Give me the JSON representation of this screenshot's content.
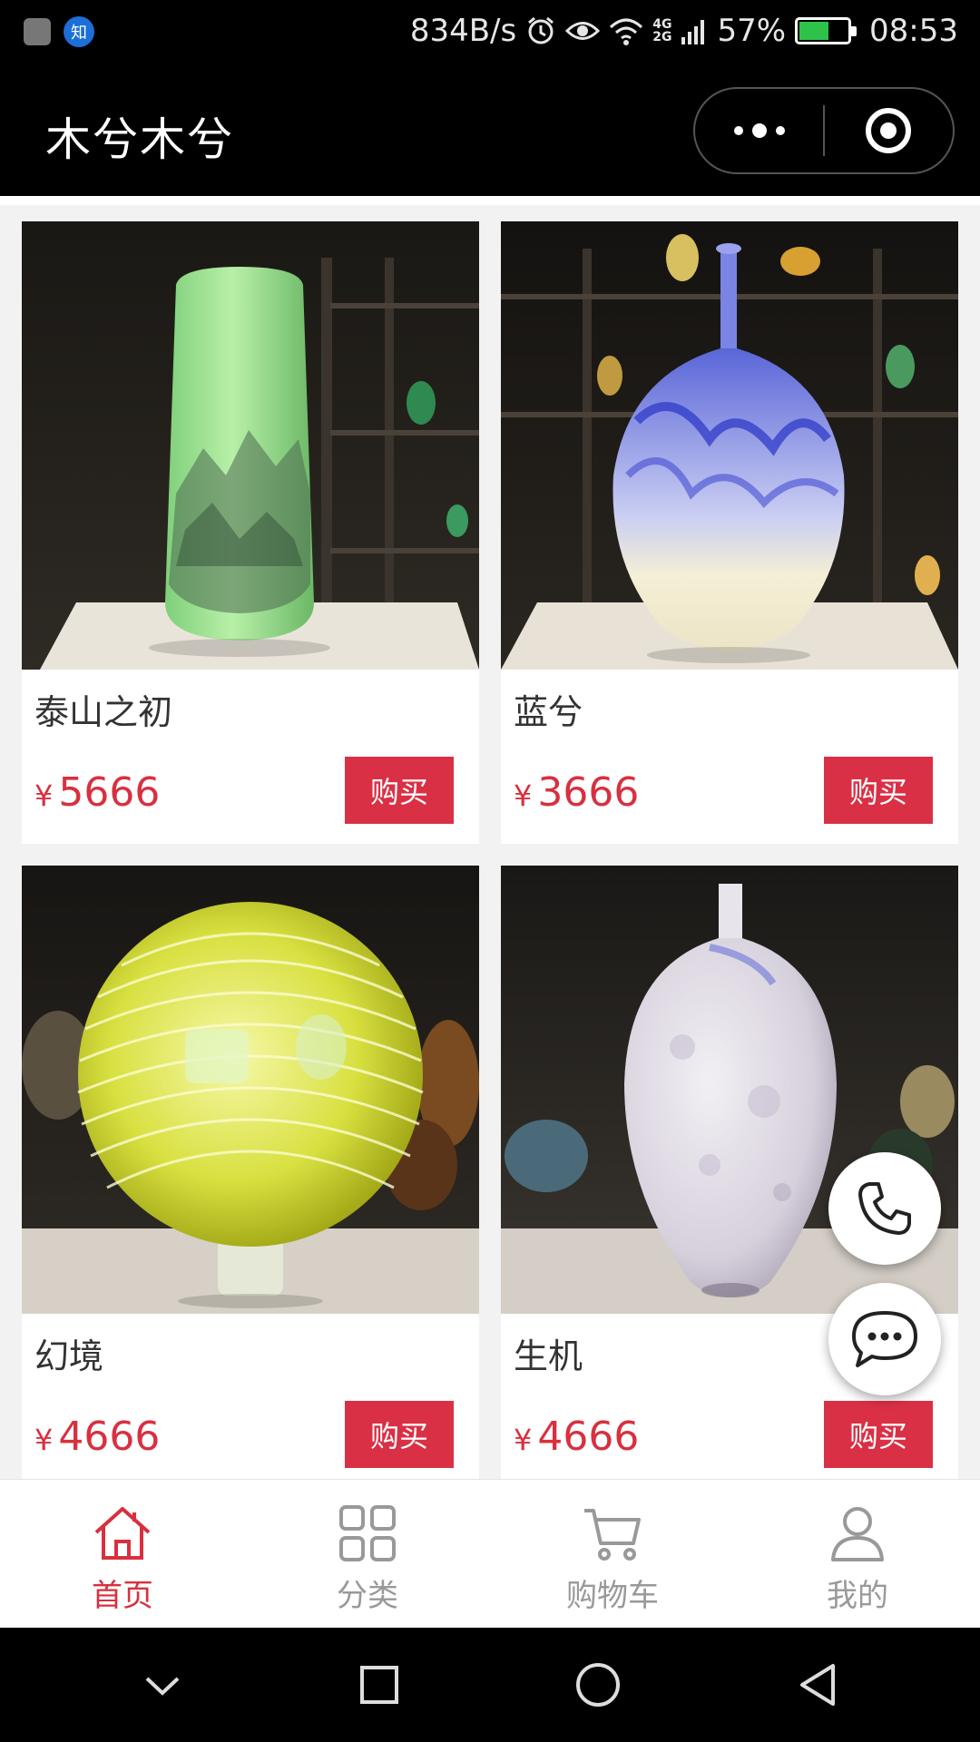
{
  "status_bar": {
    "notification_icons": [
      "image-icon",
      "zhihu-icon"
    ],
    "zhihu_label": "知",
    "network_speed": "834B/s",
    "network_type_top": "4G",
    "network_type_bottom": "2G",
    "battery_percent": "57%",
    "battery_level": 0.57,
    "time": "08:53"
  },
  "nav": {
    "title": "木兮木兮"
  },
  "products": [
    {
      "name": "泰山之初",
      "currency": "¥",
      "price": "5666",
      "buy_label": "购买",
      "photo": "green-mountain-vase"
    },
    {
      "name": "蓝兮",
      "currency": "¥",
      "price": "3666",
      "buy_label": "购买",
      "photo": "blue-swirl-bottle-vase"
    },
    {
      "name": "幻境",
      "currency": "¥",
      "price": "4666",
      "buy_label": "购买",
      "photo": "yellow-striped-sphere"
    },
    {
      "name": "生机",
      "currency": "¥",
      "price": "4666",
      "buy_label": "购买",
      "photo": "white-speckled-bottle-vase"
    }
  ],
  "floating": {
    "phone_icon": "phone-icon",
    "chat_icon": "chat-bubble-icon"
  },
  "tab_bar": {
    "tabs": [
      {
        "label": "首页",
        "icon": "home-icon",
        "active": true
      },
      {
        "label": "分类",
        "icon": "grid-icon",
        "active": false
      },
      {
        "label": "购物车",
        "icon": "cart-icon",
        "active": false
      },
      {
        "label": "我的",
        "icon": "user-icon",
        "active": false
      }
    ]
  },
  "colors": {
    "accent": "#d8303f",
    "buy_button": "#da3045",
    "inactive_tab": "#999999"
  }
}
